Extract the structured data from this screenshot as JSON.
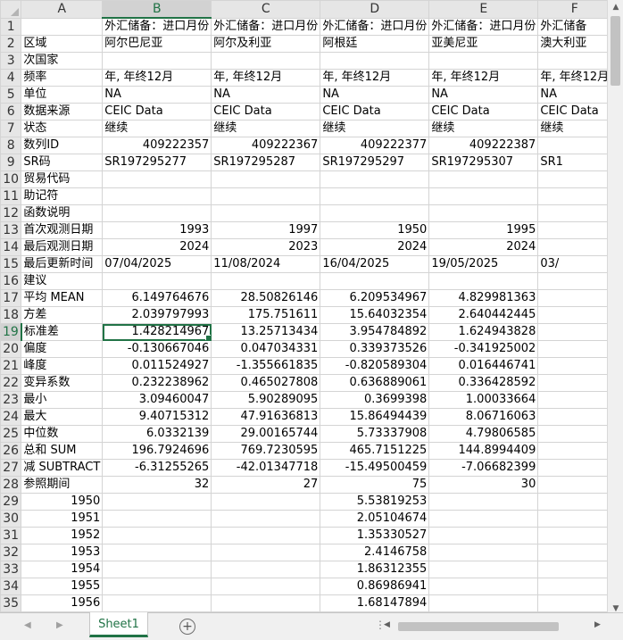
{
  "columns": [
    "A",
    "B",
    "C",
    "D",
    "E",
    "F"
  ],
  "active_col": "B",
  "active_row": 19,
  "rows": [
    {
      "n": 1,
      "cells": [
        {
          "v": "",
          "a": "t"
        },
        {
          "v": "外汇储备：进口月份",
          "a": "t"
        },
        {
          "v": "外汇储备：进口月份",
          "a": "t"
        },
        {
          "v": "外汇储备：进口月份",
          "a": "t"
        },
        {
          "v": "外汇储备：进口月份",
          "a": "t"
        },
        {
          "v": "外汇储备",
          "a": "t"
        }
      ]
    },
    {
      "n": 2,
      "cells": [
        {
          "v": "区域",
          "a": "t"
        },
        {
          "v": "阿尔巴尼亚",
          "a": "t"
        },
        {
          "v": "阿尔及利亚",
          "a": "t"
        },
        {
          "v": "阿根廷",
          "a": "t"
        },
        {
          "v": "亚美尼亚",
          "a": "t"
        },
        {
          "v": "澳大利亚",
          "a": "t"
        }
      ]
    },
    {
      "n": 3,
      "cells": [
        {
          "v": "次国家",
          "a": "t"
        },
        {
          "v": "",
          "a": "t"
        },
        {
          "v": "",
          "a": "t"
        },
        {
          "v": "",
          "a": "t"
        },
        {
          "v": "",
          "a": "t"
        },
        {
          "v": "",
          "a": "t"
        }
      ]
    },
    {
      "n": 4,
      "cells": [
        {
          "v": "频率",
          "a": "t"
        },
        {
          "v": "年, 年终12月",
          "a": "t"
        },
        {
          "v": "年, 年终12月",
          "a": "t"
        },
        {
          "v": "年, 年终12月",
          "a": "t"
        },
        {
          "v": "年, 年终12月",
          "a": "t"
        },
        {
          "v": "年, 年终12月",
          "a": "t"
        }
      ]
    },
    {
      "n": 5,
      "cells": [
        {
          "v": "单位",
          "a": "t"
        },
        {
          "v": "NA",
          "a": "t"
        },
        {
          "v": "NA",
          "a": "t"
        },
        {
          "v": "NA",
          "a": "t"
        },
        {
          "v": "NA",
          "a": "t"
        },
        {
          "v": "NA",
          "a": "t"
        }
      ]
    },
    {
      "n": 6,
      "cells": [
        {
          "v": "数据来源",
          "a": "t"
        },
        {
          "v": "CEIC Data",
          "a": "t"
        },
        {
          "v": "CEIC Data",
          "a": "t"
        },
        {
          "v": "CEIC Data",
          "a": "t"
        },
        {
          "v": "CEIC Data",
          "a": "t"
        },
        {
          "v": "CEIC Data",
          "a": "t"
        }
      ]
    },
    {
      "n": 7,
      "cells": [
        {
          "v": "状态",
          "a": "t"
        },
        {
          "v": "继续",
          "a": "t"
        },
        {
          "v": "继续",
          "a": "t"
        },
        {
          "v": "继续",
          "a": "t"
        },
        {
          "v": "继续",
          "a": "t"
        },
        {
          "v": "继续",
          "a": "t"
        }
      ]
    },
    {
      "n": 8,
      "cells": [
        {
          "v": "数列ID",
          "a": "t"
        },
        {
          "v": "409222357",
          "a": "n"
        },
        {
          "v": "409222367",
          "a": "n"
        },
        {
          "v": "409222377",
          "a": "n"
        },
        {
          "v": "409222387",
          "a": "n"
        },
        {
          "v": "",
          "a": "n"
        }
      ]
    },
    {
      "n": 9,
      "cells": [
        {
          "v": "SR码",
          "a": "t"
        },
        {
          "v": "SR197295277",
          "a": "t"
        },
        {
          "v": "SR197295287",
          "a": "t"
        },
        {
          "v": "SR197295297",
          "a": "t"
        },
        {
          "v": "SR197295307",
          "a": "t"
        },
        {
          "v": "SR1",
          "a": "t"
        }
      ]
    },
    {
      "n": 10,
      "cells": [
        {
          "v": "贸易代码",
          "a": "t"
        },
        {
          "v": "",
          "a": "t"
        },
        {
          "v": "",
          "a": "t"
        },
        {
          "v": "",
          "a": "t"
        },
        {
          "v": "",
          "a": "t"
        },
        {
          "v": "",
          "a": "t"
        }
      ]
    },
    {
      "n": 11,
      "cells": [
        {
          "v": "助记符",
          "a": "t"
        },
        {
          "v": "",
          "a": "t"
        },
        {
          "v": "",
          "a": "t"
        },
        {
          "v": "",
          "a": "t"
        },
        {
          "v": "",
          "a": "t"
        },
        {
          "v": "",
          "a": "t"
        }
      ]
    },
    {
      "n": 12,
      "cells": [
        {
          "v": "函数说明",
          "a": "t"
        },
        {
          "v": "",
          "a": "t"
        },
        {
          "v": "",
          "a": "t"
        },
        {
          "v": "",
          "a": "t"
        },
        {
          "v": "",
          "a": "t"
        },
        {
          "v": "",
          "a": "t"
        }
      ]
    },
    {
      "n": 13,
      "cells": [
        {
          "v": "首次观测日期",
          "a": "t"
        },
        {
          "v": "1993",
          "a": "n"
        },
        {
          "v": "1997",
          "a": "n"
        },
        {
          "v": "1950",
          "a": "n"
        },
        {
          "v": "1995",
          "a": "n"
        },
        {
          "v": "",
          "a": "n"
        }
      ]
    },
    {
      "n": 14,
      "cells": [
        {
          "v": "最后观测日期",
          "a": "t"
        },
        {
          "v": "2024",
          "a": "n"
        },
        {
          "v": "2023",
          "a": "n"
        },
        {
          "v": "2024",
          "a": "n"
        },
        {
          "v": "2024",
          "a": "n"
        },
        {
          "v": "",
          "a": "n"
        }
      ]
    },
    {
      "n": 15,
      "cells": [
        {
          "v": "最后更新时间",
          "a": "t"
        },
        {
          "v": "07/04/2025",
          "a": "t"
        },
        {
          "v": "11/08/2024",
          "a": "t"
        },
        {
          "v": "16/04/2025",
          "a": "t"
        },
        {
          "v": "19/05/2025",
          "a": "t"
        },
        {
          "v": "03/",
          "a": "t"
        }
      ]
    },
    {
      "n": 16,
      "cells": [
        {
          "v": "建议",
          "a": "t"
        },
        {
          "v": "",
          "a": "t"
        },
        {
          "v": "",
          "a": "t"
        },
        {
          "v": "",
          "a": "t"
        },
        {
          "v": "",
          "a": "t"
        },
        {
          "v": "",
          "a": "t"
        }
      ]
    },
    {
      "n": 17,
      "cells": [
        {
          "v": "平均 MEAN",
          "a": "t"
        },
        {
          "v": "6.149764676",
          "a": "n"
        },
        {
          "v": "28.50826146",
          "a": "n"
        },
        {
          "v": "6.209534967",
          "a": "n"
        },
        {
          "v": "4.829981363",
          "a": "n"
        },
        {
          "v": "",
          "a": "n"
        }
      ]
    },
    {
      "n": 18,
      "cells": [
        {
          "v": "方差",
          "a": "t"
        },
        {
          "v": "2.039797993",
          "a": "n"
        },
        {
          "v": "175.751611",
          "a": "n"
        },
        {
          "v": "15.64032354",
          "a": "n"
        },
        {
          "v": "2.640442445",
          "a": "n"
        },
        {
          "v": "",
          "a": "n"
        }
      ]
    },
    {
      "n": 19,
      "cells": [
        {
          "v": "标准差",
          "a": "t"
        },
        {
          "v": "1.428214967",
          "a": "n"
        },
        {
          "v": "13.25713434",
          "a": "n"
        },
        {
          "v": "3.954784892",
          "a": "n"
        },
        {
          "v": "1.624943828",
          "a": "n"
        },
        {
          "v": "",
          "a": "n"
        }
      ]
    },
    {
      "n": 20,
      "cells": [
        {
          "v": "偏度",
          "a": "t"
        },
        {
          "v": "-0.130667046",
          "a": "n"
        },
        {
          "v": "0.047034331",
          "a": "n"
        },
        {
          "v": "0.339373526",
          "a": "n"
        },
        {
          "v": "-0.341925002",
          "a": "n"
        },
        {
          "v": "",
          "a": "n"
        }
      ]
    },
    {
      "n": 21,
      "cells": [
        {
          "v": "峰度",
          "a": "t"
        },
        {
          "v": "0.011524927",
          "a": "n"
        },
        {
          "v": "-1.355661835",
          "a": "n"
        },
        {
          "v": "-0.820589304",
          "a": "n"
        },
        {
          "v": "0.016446741",
          "a": "n"
        },
        {
          "v": "",
          "a": "n"
        }
      ]
    },
    {
      "n": 22,
      "cells": [
        {
          "v": "变异系数",
          "a": "t"
        },
        {
          "v": "0.232238962",
          "a": "n"
        },
        {
          "v": "0.465027808",
          "a": "n"
        },
        {
          "v": "0.636889061",
          "a": "n"
        },
        {
          "v": "0.336428592",
          "a": "n"
        },
        {
          "v": "",
          "a": "n"
        }
      ]
    },
    {
      "n": 23,
      "cells": [
        {
          "v": "最小",
          "a": "t"
        },
        {
          "v": "3.09460047",
          "a": "n"
        },
        {
          "v": "5.90289095",
          "a": "n"
        },
        {
          "v": "0.3699398",
          "a": "n"
        },
        {
          "v": "1.00033664",
          "a": "n"
        },
        {
          "v": "",
          "a": "n"
        }
      ]
    },
    {
      "n": 24,
      "cells": [
        {
          "v": "最大",
          "a": "t"
        },
        {
          "v": "9.40715312",
          "a": "n"
        },
        {
          "v": "47.91636813",
          "a": "n"
        },
        {
          "v": "15.86494439",
          "a": "n"
        },
        {
          "v": "8.06716063",
          "a": "n"
        },
        {
          "v": "",
          "a": "n"
        }
      ]
    },
    {
      "n": 25,
      "cells": [
        {
          "v": "中位数",
          "a": "t"
        },
        {
          "v": "6.0332139",
          "a": "n"
        },
        {
          "v": "29.00165744",
          "a": "n"
        },
        {
          "v": "5.73337908",
          "a": "n"
        },
        {
          "v": "4.79806585",
          "a": "n"
        },
        {
          "v": "",
          "a": "n"
        }
      ]
    },
    {
      "n": 26,
      "cells": [
        {
          "v": "总和 SUM",
          "a": "t"
        },
        {
          "v": "196.7924696",
          "a": "n"
        },
        {
          "v": "769.7230595",
          "a": "n"
        },
        {
          "v": "465.7151225",
          "a": "n"
        },
        {
          "v": "144.8994409",
          "a": "n"
        },
        {
          "v": "",
          "a": "n"
        }
      ]
    },
    {
      "n": 27,
      "cells": [
        {
          "v": "减 SUBTRACT",
          "a": "t"
        },
        {
          "v": "-6.31255265",
          "a": "n"
        },
        {
          "v": "-42.01347718",
          "a": "n"
        },
        {
          "v": "-15.49500459",
          "a": "n"
        },
        {
          "v": "-7.06682399",
          "a": "n"
        },
        {
          "v": "",
          "a": "n"
        }
      ]
    },
    {
      "n": 28,
      "cells": [
        {
          "v": "参照期间",
          "a": "t"
        },
        {
          "v": "32",
          "a": "n"
        },
        {
          "v": "27",
          "a": "n"
        },
        {
          "v": "75",
          "a": "n"
        },
        {
          "v": "30",
          "a": "n"
        },
        {
          "v": "",
          "a": "n"
        }
      ]
    },
    {
      "n": 29,
      "cells": [
        {
          "v": "1950",
          "a": "n"
        },
        {
          "v": "",
          "a": "n"
        },
        {
          "v": "",
          "a": "n"
        },
        {
          "v": "5.53819253",
          "a": "n"
        },
        {
          "v": "",
          "a": "n"
        },
        {
          "v": "",
          "a": "n"
        }
      ]
    },
    {
      "n": 30,
      "cells": [
        {
          "v": "1951",
          "a": "n"
        },
        {
          "v": "",
          "a": "n"
        },
        {
          "v": "",
          "a": "n"
        },
        {
          "v": "2.05104674",
          "a": "n"
        },
        {
          "v": "",
          "a": "n"
        },
        {
          "v": "",
          "a": "n"
        }
      ]
    },
    {
      "n": 31,
      "cells": [
        {
          "v": "1952",
          "a": "n"
        },
        {
          "v": "",
          "a": "n"
        },
        {
          "v": "",
          "a": "n"
        },
        {
          "v": "1.35330527",
          "a": "n"
        },
        {
          "v": "",
          "a": "n"
        },
        {
          "v": "",
          "a": "n"
        }
      ]
    },
    {
      "n": 32,
      "cells": [
        {
          "v": "1953",
          "a": "n"
        },
        {
          "v": "",
          "a": "n"
        },
        {
          "v": "",
          "a": "n"
        },
        {
          "v": "2.4146758",
          "a": "n"
        },
        {
          "v": "",
          "a": "n"
        },
        {
          "v": "",
          "a": "n"
        }
      ]
    },
    {
      "n": 33,
      "cells": [
        {
          "v": "1954",
          "a": "n"
        },
        {
          "v": "",
          "a": "n"
        },
        {
          "v": "",
          "a": "n"
        },
        {
          "v": "1.86312355",
          "a": "n"
        },
        {
          "v": "",
          "a": "n"
        },
        {
          "v": "",
          "a": "n"
        }
      ]
    },
    {
      "n": 34,
      "cells": [
        {
          "v": "1955",
          "a": "n"
        },
        {
          "v": "",
          "a": "n"
        },
        {
          "v": "",
          "a": "n"
        },
        {
          "v": "0.86986941",
          "a": "n"
        },
        {
          "v": "",
          "a": "n"
        },
        {
          "v": "",
          "a": "n"
        }
      ]
    },
    {
      "n": 35,
      "cells": [
        {
          "v": "1956",
          "a": "n"
        },
        {
          "v": "",
          "a": "n"
        },
        {
          "v": "",
          "a": "n"
        },
        {
          "v": "1.68147894",
          "a": "n"
        },
        {
          "v": "",
          "a": "n"
        },
        {
          "v": "",
          "a": "n"
        }
      ]
    }
  ],
  "sheet_tab": {
    "label": "Sheet1"
  },
  "add_sheet": {
    "label": "+"
  },
  "icons": {
    "nav_prev": "triangle-left-icon",
    "nav_next": "triangle-right-icon",
    "scroll_up": "triangle-up-icon",
    "scroll_down": "triangle-down-icon"
  },
  "colors": {
    "accent": "#217346"
  }
}
